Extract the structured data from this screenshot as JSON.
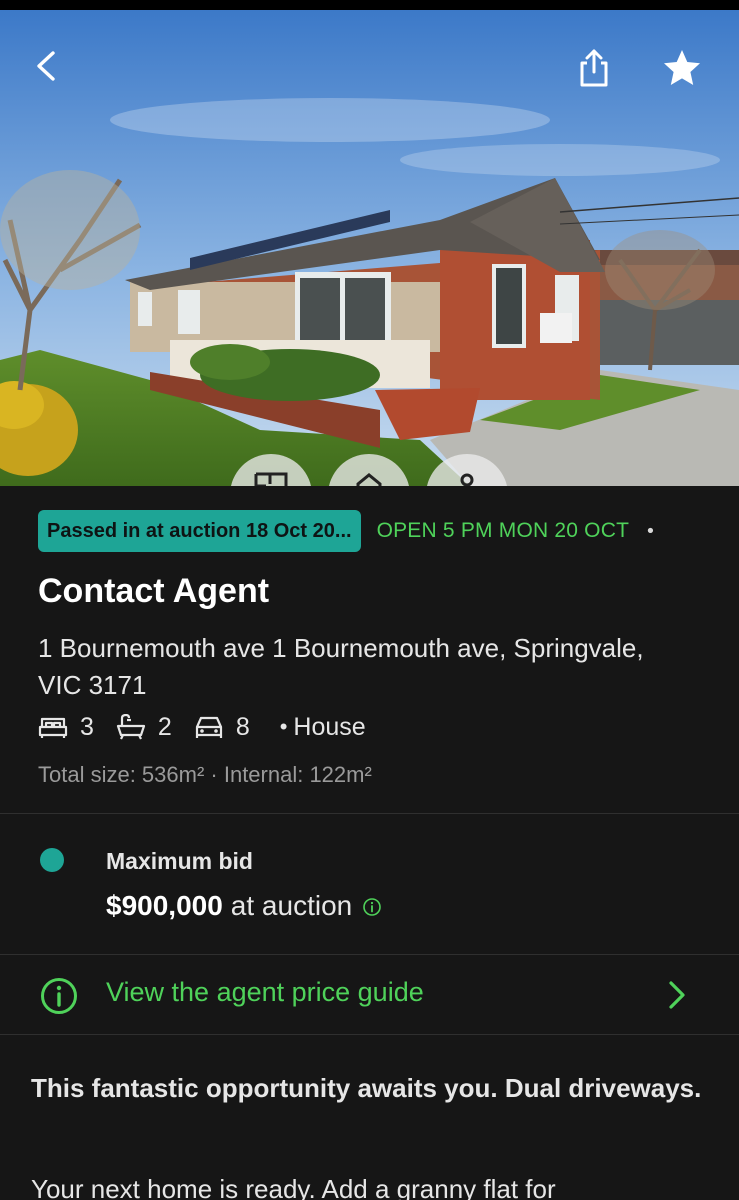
{
  "hero": {
    "back_icon": "chevron-left-icon",
    "share_icon": "share-icon",
    "favourite_icon": "star-icon",
    "feature_bubbles": [
      "floorplan-icon",
      "home-icon",
      "person-icon"
    ]
  },
  "listing": {
    "auction_badge": "Passed in at auction 18 Oct 20...",
    "open_time": "OPEN 5 PM MON 20 OCT",
    "badge_separator": "•",
    "price_heading": "Contact Agent",
    "address": "1 Bournemouth ave 1 Bournemouth ave, Springvale, VIC 3171",
    "features": {
      "beds": "3",
      "baths": "2",
      "parking": "8",
      "separator": "•",
      "type": "House"
    },
    "size_line": "Total size: 536m² · Internal: 122m²"
  },
  "bid": {
    "label": "Maximum bid",
    "amount": "$900,000",
    "suffix": "at auction"
  },
  "price_guide": {
    "label": "View the agent price guide"
  },
  "description": {
    "title": "This fantastic opportunity awaits you. Dual driveways.",
    "body": "Your next home is ready. Add a granny flat for"
  },
  "colors": {
    "background": "#161616",
    "accent_teal": "#1ea596",
    "accent_green": "#4fd25a",
    "muted_text": "#9a9a9a"
  }
}
